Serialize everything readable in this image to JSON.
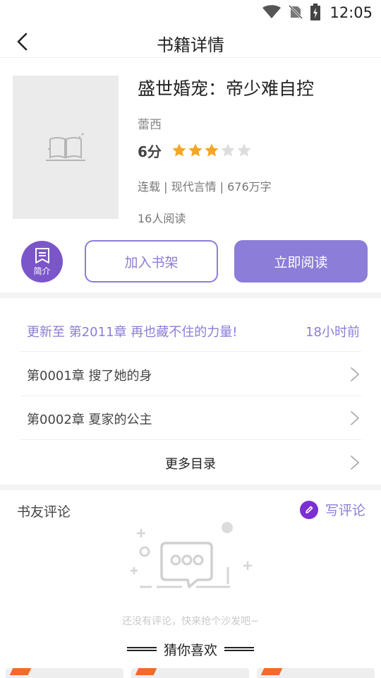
{
  "status_bar": {
    "time": "12:05"
  },
  "nav": {
    "title": "书籍详情"
  },
  "book": {
    "title": "盛世婚宠：帝少难自控",
    "author": "蕾西",
    "score": "6分",
    "rating": 3,
    "rating_max": 5,
    "meta": "连载 | 现代言情 | 676万字",
    "readers": "16人阅读"
  },
  "actions": {
    "intro_label": "简介",
    "add_shelf_label": "加入书架",
    "read_now_label": "立即阅读"
  },
  "catalog": {
    "update_text": "更新至 第2011章 再也藏不住的力量!",
    "update_time": "18小时前",
    "chapters": [
      {
        "label": "第0001章 搜了她的身"
      },
      {
        "label": "第0002章 夏家的公主"
      }
    ],
    "more_label": "更多目录"
  },
  "reviews": {
    "title": "书友评论",
    "write_label": "写评论",
    "empty_text": "还没有评论，快来抢个沙发吧~"
  },
  "recommend": {
    "title": "猜你喜欢"
  },
  "colors": {
    "accent": "#8b7dd8",
    "intro_bg": "#7b56c9",
    "star": "#f5a623",
    "star_empty": "#dddddd"
  }
}
